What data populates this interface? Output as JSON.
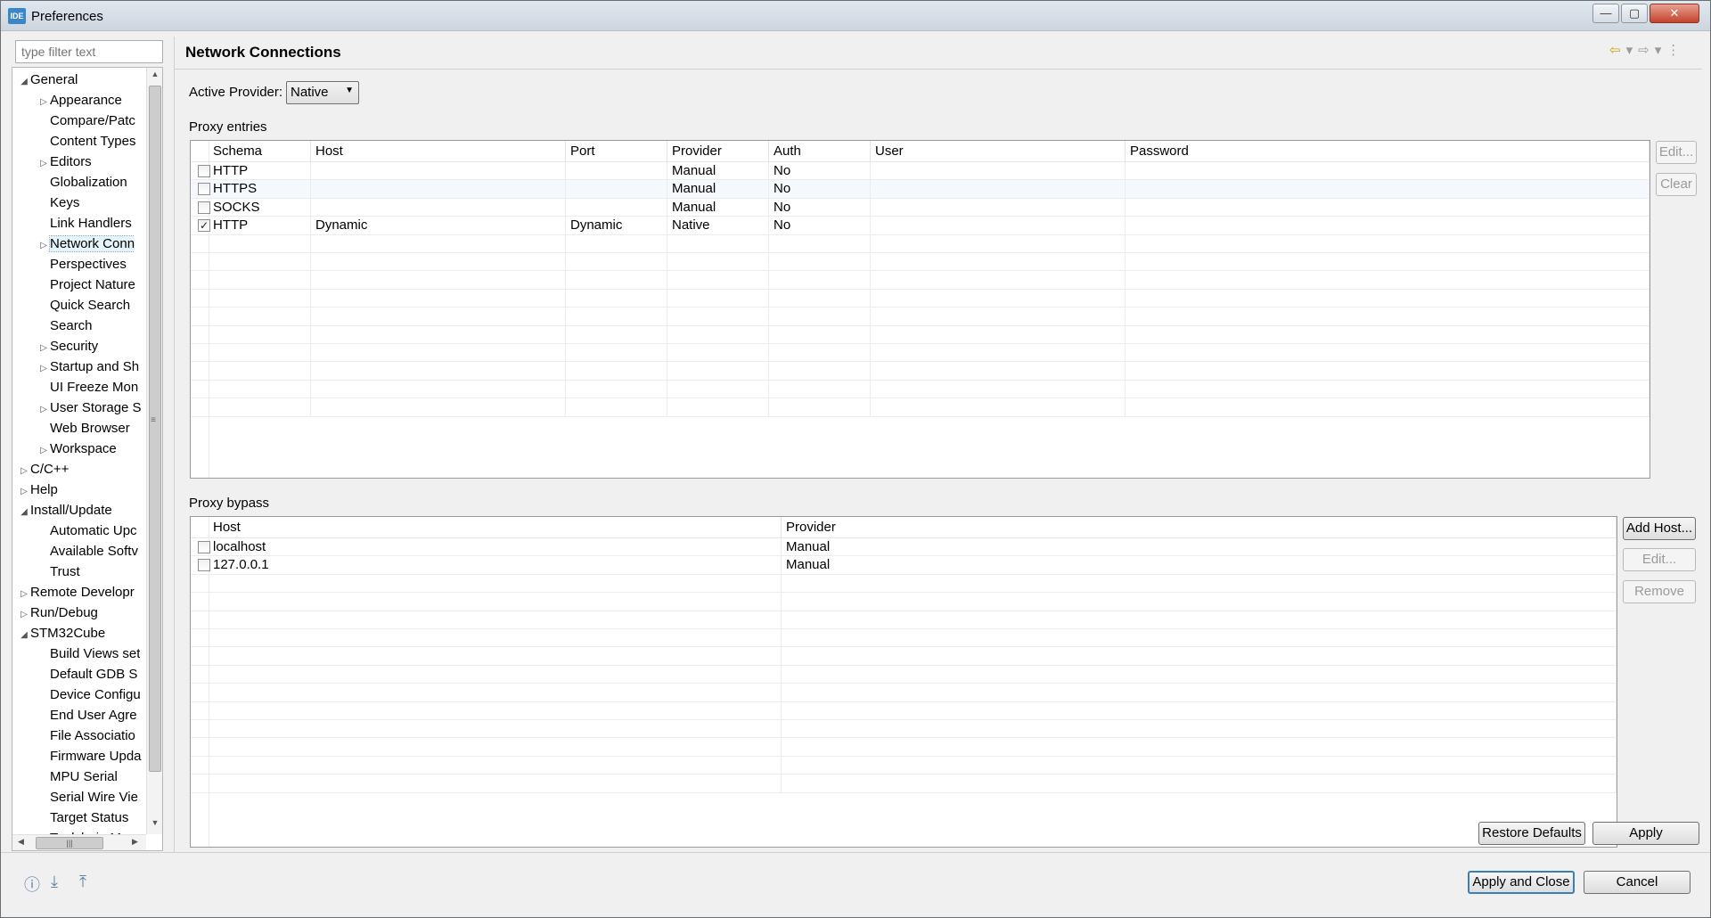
{
  "window": {
    "title": "Preferences",
    "app_icon_text": "IDE",
    "buttons": {
      "minimize": "—",
      "maximize": "▢",
      "close": "✕"
    }
  },
  "sidebar": {
    "filter_placeholder": "type filter text",
    "tree": [
      {
        "label": "General",
        "level": 0,
        "expander": "expanded"
      },
      {
        "label": "Appearance",
        "level": 1,
        "expander": "collapsed"
      },
      {
        "label": "Compare/Patc",
        "level": 1,
        "expander": "none"
      },
      {
        "label": "Content Types",
        "level": 1,
        "expander": "none"
      },
      {
        "label": "Editors",
        "level": 1,
        "expander": "collapsed"
      },
      {
        "label": "Globalization",
        "level": 1,
        "expander": "none"
      },
      {
        "label": "Keys",
        "level": 1,
        "expander": "none"
      },
      {
        "label": "Link Handlers",
        "level": 1,
        "expander": "none"
      },
      {
        "label": "Network Conn",
        "level": 1,
        "expander": "collapsed",
        "selected": true
      },
      {
        "label": "Perspectives",
        "level": 1,
        "expander": "none"
      },
      {
        "label": "Project Nature",
        "level": 1,
        "expander": "none"
      },
      {
        "label": "Quick Search",
        "level": 1,
        "expander": "none"
      },
      {
        "label": "Search",
        "level": 1,
        "expander": "none"
      },
      {
        "label": "Security",
        "level": 1,
        "expander": "collapsed"
      },
      {
        "label": "Startup and Sh",
        "level": 1,
        "expander": "collapsed"
      },
      {
        "label": "UI Freeze Mon",
        "level": 1,
        "expander": "none"
      },
      {
        "label": "User Storage S",
        "level": 1,
        "expander": "collapsed"
      },
      {
        "label": "Web Browser",
        "level": 1,
        "expander": "none"
      },
      {
        "label": "Workspace",
        "level": 1,
        "expander": "collapsed"
      },
      {
        "label": "C/C++",
        "level": 0,
        "expander": "collapsed"
      },
      {
        "label": "Help",
        "level": 0,
        "expander": "collapsed"
      },
      {
        "label": "Install/Update",
        "level": 0,
        "expander": "expanded"
      },
      {
        "label": "Automatic Upc",
        "level": 1,
        "expander": "none"
      },
      {
        "label": "Available Softv",
        "level": 1,
        "expander": "none"
      },
      {
        "label": "Trust",
        "level": 1,
        "expander": "none"
      },
      {
        "label": "Remote Developr",
        "level": 0,
        "expander": "collapsed"
      },
      {
        "label": "Run/Debug",
        "level": 0,
        "expander": "collapsed"
      },
      {
        "label": "STM32Cube",
        "level": 0,
        "expander": "expanded"
      },
      {
        "label": "Build Views set",
        "level": 1,
        "expander": "none"
      },
      {
        "label": "Default GDB S",
        "level": 1,
        "expander": "none"
      },
      {
        "label": "Device Configu",
        "level": 1,
        "expander": "none"
      },
      {
        "label": "End User Agre",
        "level": 1,
        "expander": "none"
      },
      {
        "label": "File Associatio",
        "level": 1,
        "expander": "none"
      },
      {
        "label": "Firmware Upda",
        "level": 1,
        "expander": "none"
      },
      {
        "label": "MPU Serial",
        "level": 1,
        "expander": "none"
      },
      {
        "label": "Serial Wire Vie",
        "level": 1,
        "expander": "none"
      },
      {
        "label": "Target Status",
        "level": 1,
        "expander": "none"
      },
      {
        "label": "Toolchain M",
        "level": 1,
        "expander": "none"
      }
    ]
  },
  "main": {
    "title": "Network Connections",
    "active_provider_label": "Active Provider:",
    "active_provider_value": "Native",
    "proxy_entries": {
      "label": "Proxy entries",
      "columns": [
        "Schema",
        "Host",
        "Port",
        "Provider",
        "Auth",
        "User",
        "Password"
      ],
      "rows": [
        {
          "checked": false,
          "cells": [
            "HTTP",
            "",
            "",
            "Manual",
            "No",
            "",
            ""
          ]
        },
        {
          "checked": false,
          "cells": [
            "HTTPS",
            "",
            "",
            "Manual",
            "No",
            "",
            ""
          ]
        },
        {
          "checked": false,
          "cells": [
            "SOCKS",
            "",
            "",
            "Manual",
            "No",
            "",
            ""
          ]
        },
        {
          "checked": true,
          "cells": [
            "HTTP",
            "Dynamic",
            "Dynamic",
            "Native",
            "No",
            "",
            ""
          ]
        }
      ],
      "buttons": {
        "edit": "Edit...",
        "clear": "Clear"
      }
    },
    "proxy_bypass": {
      "label": "Proxy bypass",
      "columns": [
        "Host",
        "Provider"
      ],
      "rows": [
        {
          "checked": false,
          "cells": [
            "localhost",
            "Manual"
          ]
        },
        {
          "checked": false,
          "cells": [
            "127.0.0.1",
            "Manual"
          ]
        }
      ],
      "buttons": {
        "add_host": "Add Host...",
        "edit": "Edit...",
        "remove": "Remove"
      }
    },
    "restore_defaults": "Restore Defaults",
    "apply": "Apply"
  },
  "footer": {
    "apply_and_close": "Apply and Close",
    "cancel": "Cancel"
  }
}
